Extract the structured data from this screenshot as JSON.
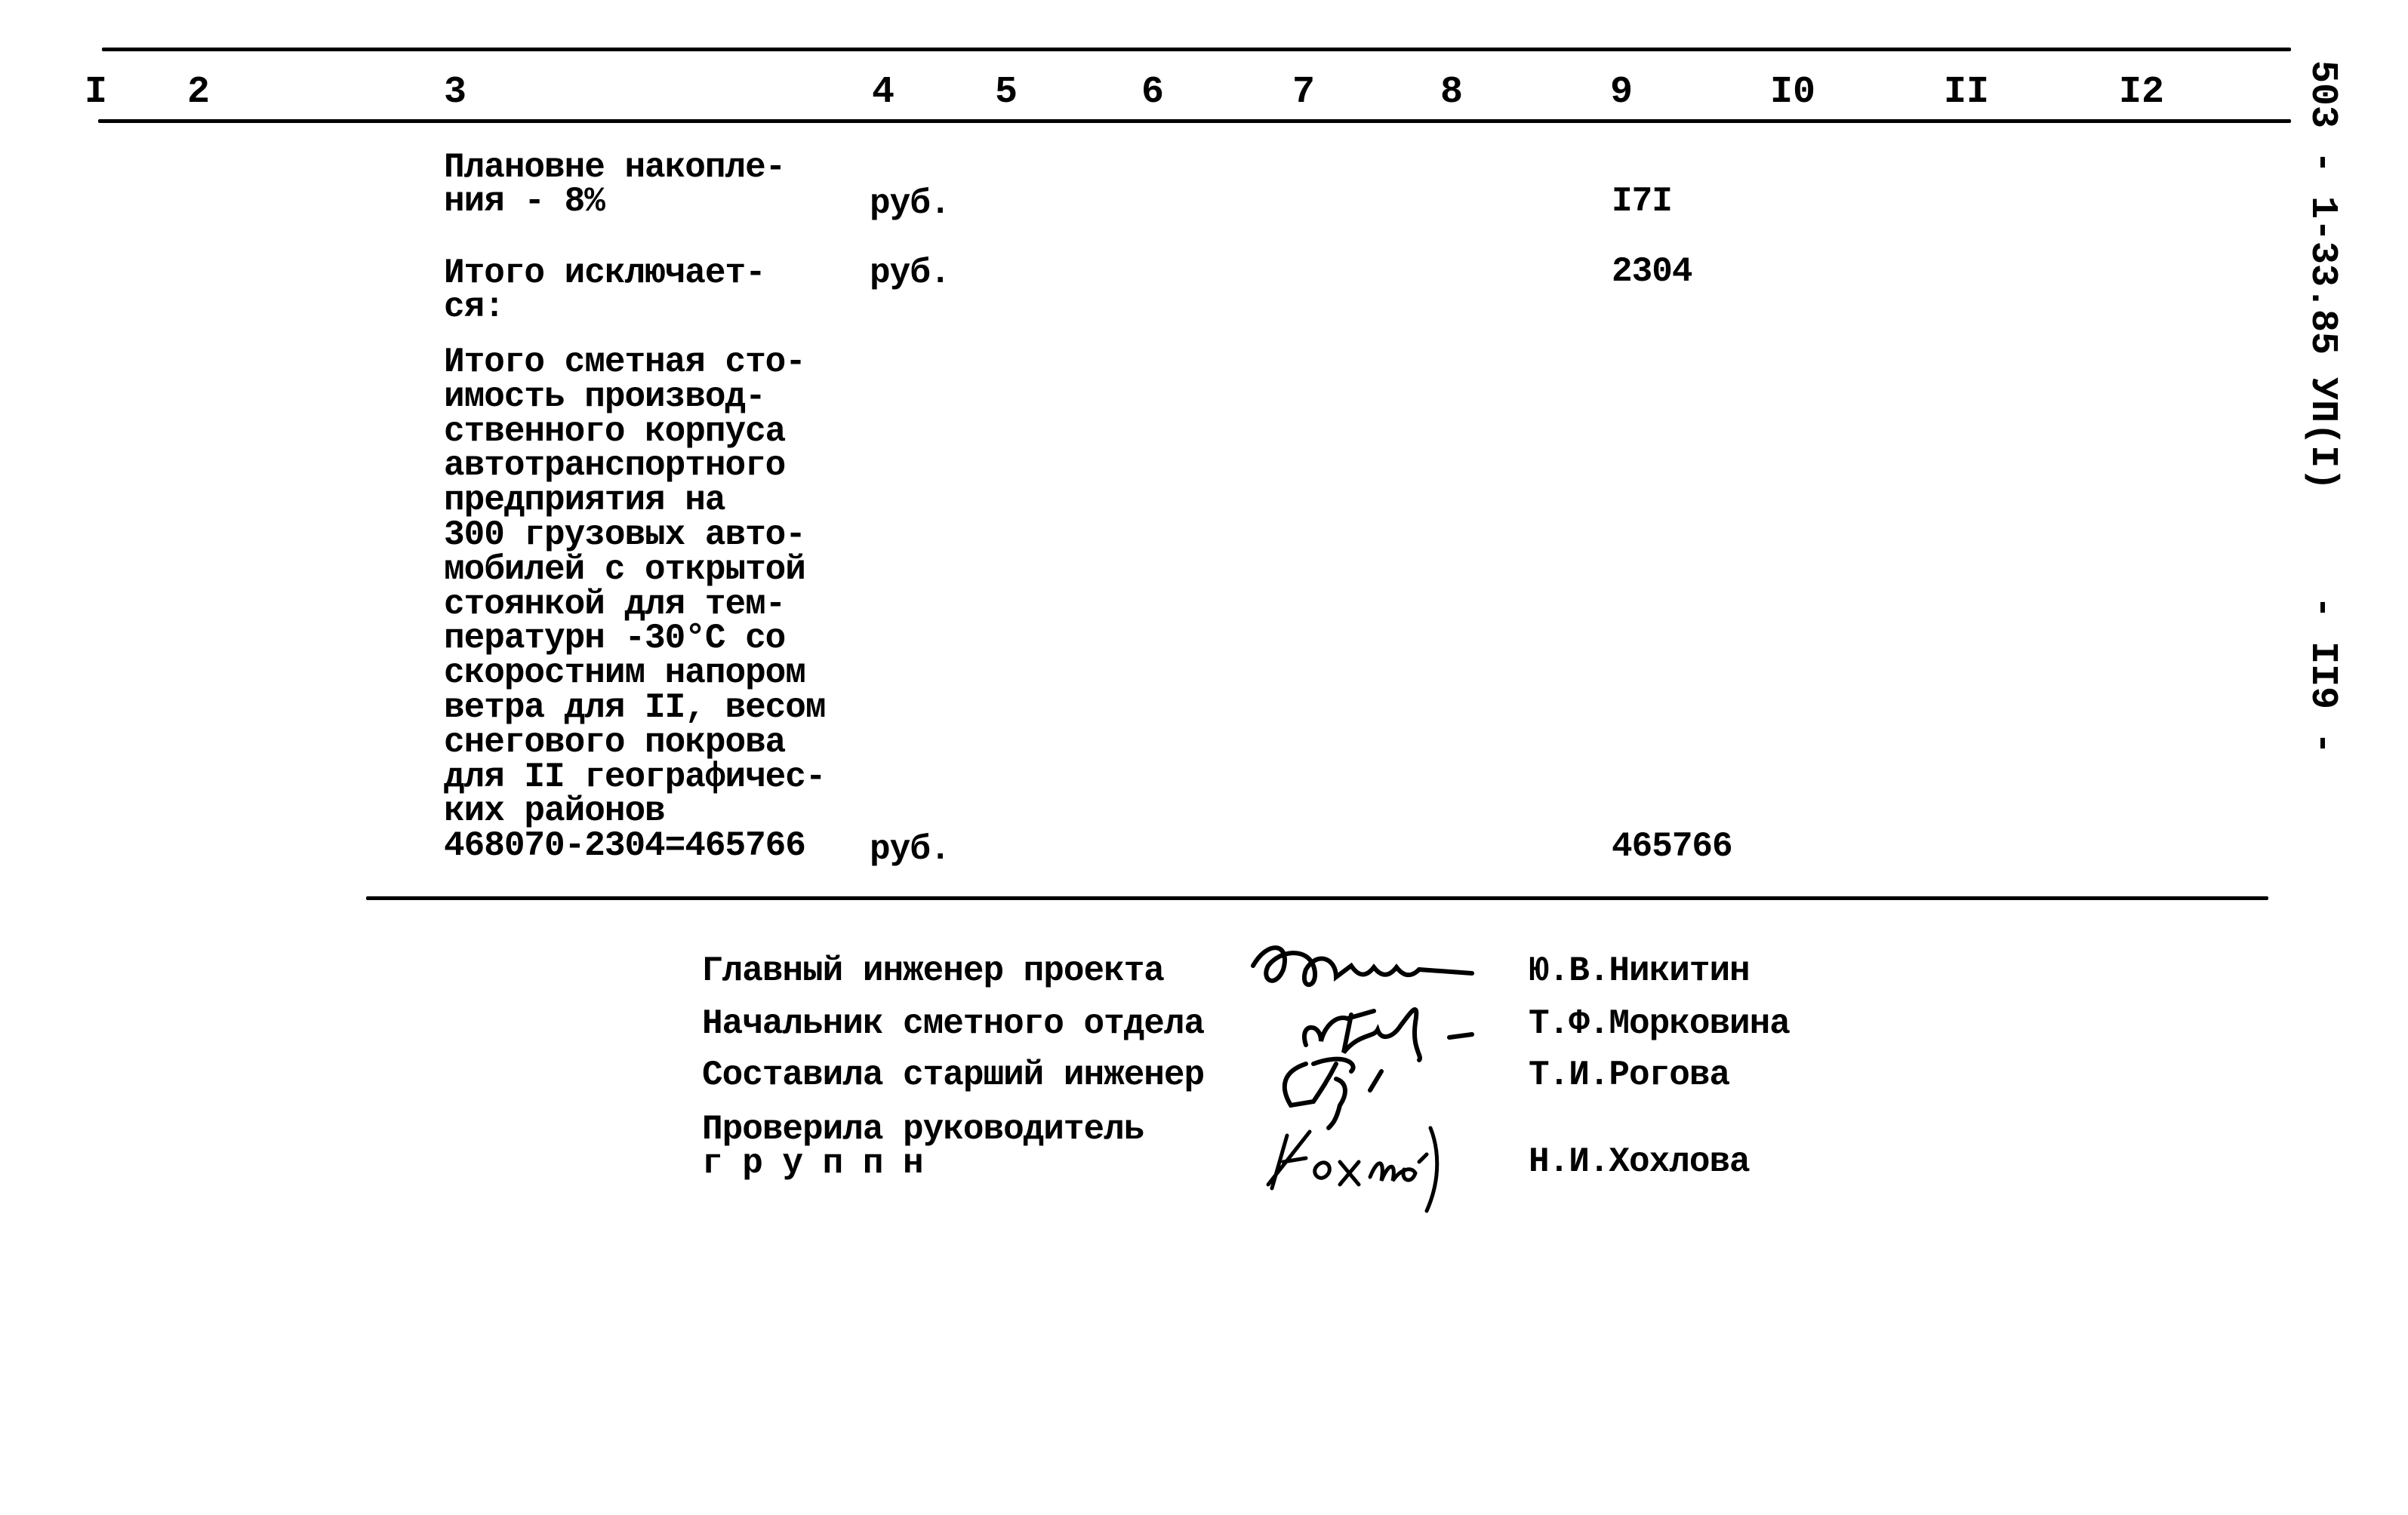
{
  "header": {
    "columns": [
      "I",
      "2",
      "3",
      "4",
      "5",
      "6",
      "7",
      "8",
      "9",
      "I0",
      "II",
      "I2"
    ]
  },
  "side_code": "503 - 1-33.85 УП(I)",
  "page_number": "- II9 -",
  "rows": [
    {
      "description": "Плановне накопле-\nния - 8%",
      "unit": "руб.",
      "value": "I7I"
    },
    {
      "description": "Итого исключает-\nся:",
      "unit": "руб.",
      "value": "2304"
    },
    {
      "description": "Итого сметная сто-\nимость производ-\nственного корпуса\nавтотранспортного\nпредприятия на\n300 грузовых авто-\nмобилей с открытой\nстоянкой для тем-\nпературн -30°С со\nскоростним напором\nветра для II, весом\nснегового покрова\nдля II географичес-\nких районов\n468070-2304=465766",
      "unit": "руб.",
      "value": "465766"
    }
  ],
  "signatures": [
    {
      "role": "Главный инженер проекта",
      "name": "Ю.В.Никитин",
      "signature": "handwritten-signature"
    },
    {
      "role": "Начальник сметного отдела",
      "name": "Т.Ф.Морковина",
      "signature": "handwritten-signature"
    },
    {
      "role": "Составила старший инженер",
      "name": "Т.И.Рогова",
      "signature": "handwritten-signature"
    },
    {
      "role": "Проверила руководитель\nг р у п п н",
      "name": "Н.И.Хохлова",
      "signature": "handwritten-signature"
    }
  ]
}
